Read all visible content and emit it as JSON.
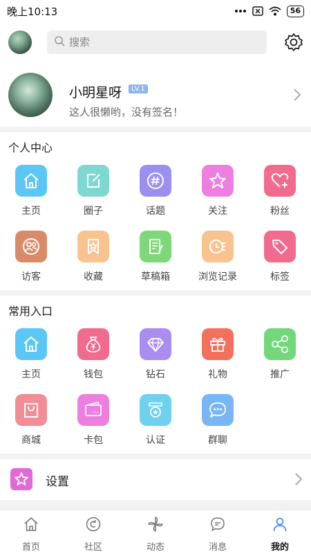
{
  "status": {
    "time": "晚上10:13",
    "battery": "56"
  },
  "search": {
    "placeholder": "搜索"
  },
  "profile": {
    "nickname": "小明星呀",
    "level": "LV.1",
    "signature": "这人很懒哟，没有签名！"
  },
  "sections": {
    "personal": {
      "title": "个人中心",
      "items": [
        {
          "label": "主页",
          "icon": "home-icon",
          "color": "#5cc6f7"
        },
        {
          "label": "圈子",
          "icon": "edit-square-icon",
          "color": "#7fd8cf"
        },
        {
          "label": "话题",
          "icon": "hashtag-icon",
          "color": "#9b8ff0"
        },
        {
          "label": "关注",
          "icon": "star-icon",
          "color": "#ec7fe0"
        },
        {
          "label": "粉丝",
          "icon": "heart-plus-icon",
          "color": "#f06b8e"
        },
        {
          "label": "访客",
          "icon": "visitors-icon",
          "color": "#d98b67"
        },
        {
          "label": "收藏",
          "icon": "bookmark-star-icon",
          "color": "#f9c38f"
        },
        {
          "label": "草稿箱",
          "icon": "draft-icon",
          "color": "#7ed87a"
        },
        {
          "label": "浏览记录",
          "icon": "history-icon",
          "color": "#f9c38f"
        },
        {
          "label": "标签",
          "icon": "tag-icon",
          "color": "#f06b8e"
        }
      ]
    },
    "common": {
      "title": "常用入口",
      "items": [
        {
          "label": "主页",
          "icon": "home-icon",
          "color": "#5cc6f7"
        },
        {
          "label": "钱包",
          "icon": "money-bag-icon",
          "color": "#f06b8e"
        },
        {
          "label": "钻石",
          "icon": "diamond-icon",
          "color": "#a98ef0"
        },
        {
          "label": "礼物",
          "icon": "gift-icon",
          "color": "#f5705c"
        },
        {
          "label": "推广",
          "icon": "share-icon",
          "color": "#72d87a"
        },
        {
          "label": "商城",
          "icon": "shopping-bag-icon",
          "color": "#f28c95"
        },
        {
          "label": "卡包",
          "icon": "card-wallet-icon",
          "color": "#ec7fe0"
        },
        {
          "label": "认证",
          "icon": "certificate-icon",
          "color": "#6fd0f0"
        },
        {
          "label": "群聊",
          "icon": "chat-bubble-icon",
          "color": "#79b6f5"
        }
      ]
    }
  },
  "settings": {
    "label": "设置"
  },
  "tabs": [
    {
      "label": "首页",
      "icon": "home-outline-icon"
    },
    {
      "label": "社区",
      "icon": "community-icon"
    },
    {
      "label": "动态",
      "icon": "pinwheel-icon"
    },
    {
      "label": "消息",
      "icon": "message-icon"
    },
    {
      "label": "我的",
      "icon": "user-icon",
      "active": true
    }
  ]
}
